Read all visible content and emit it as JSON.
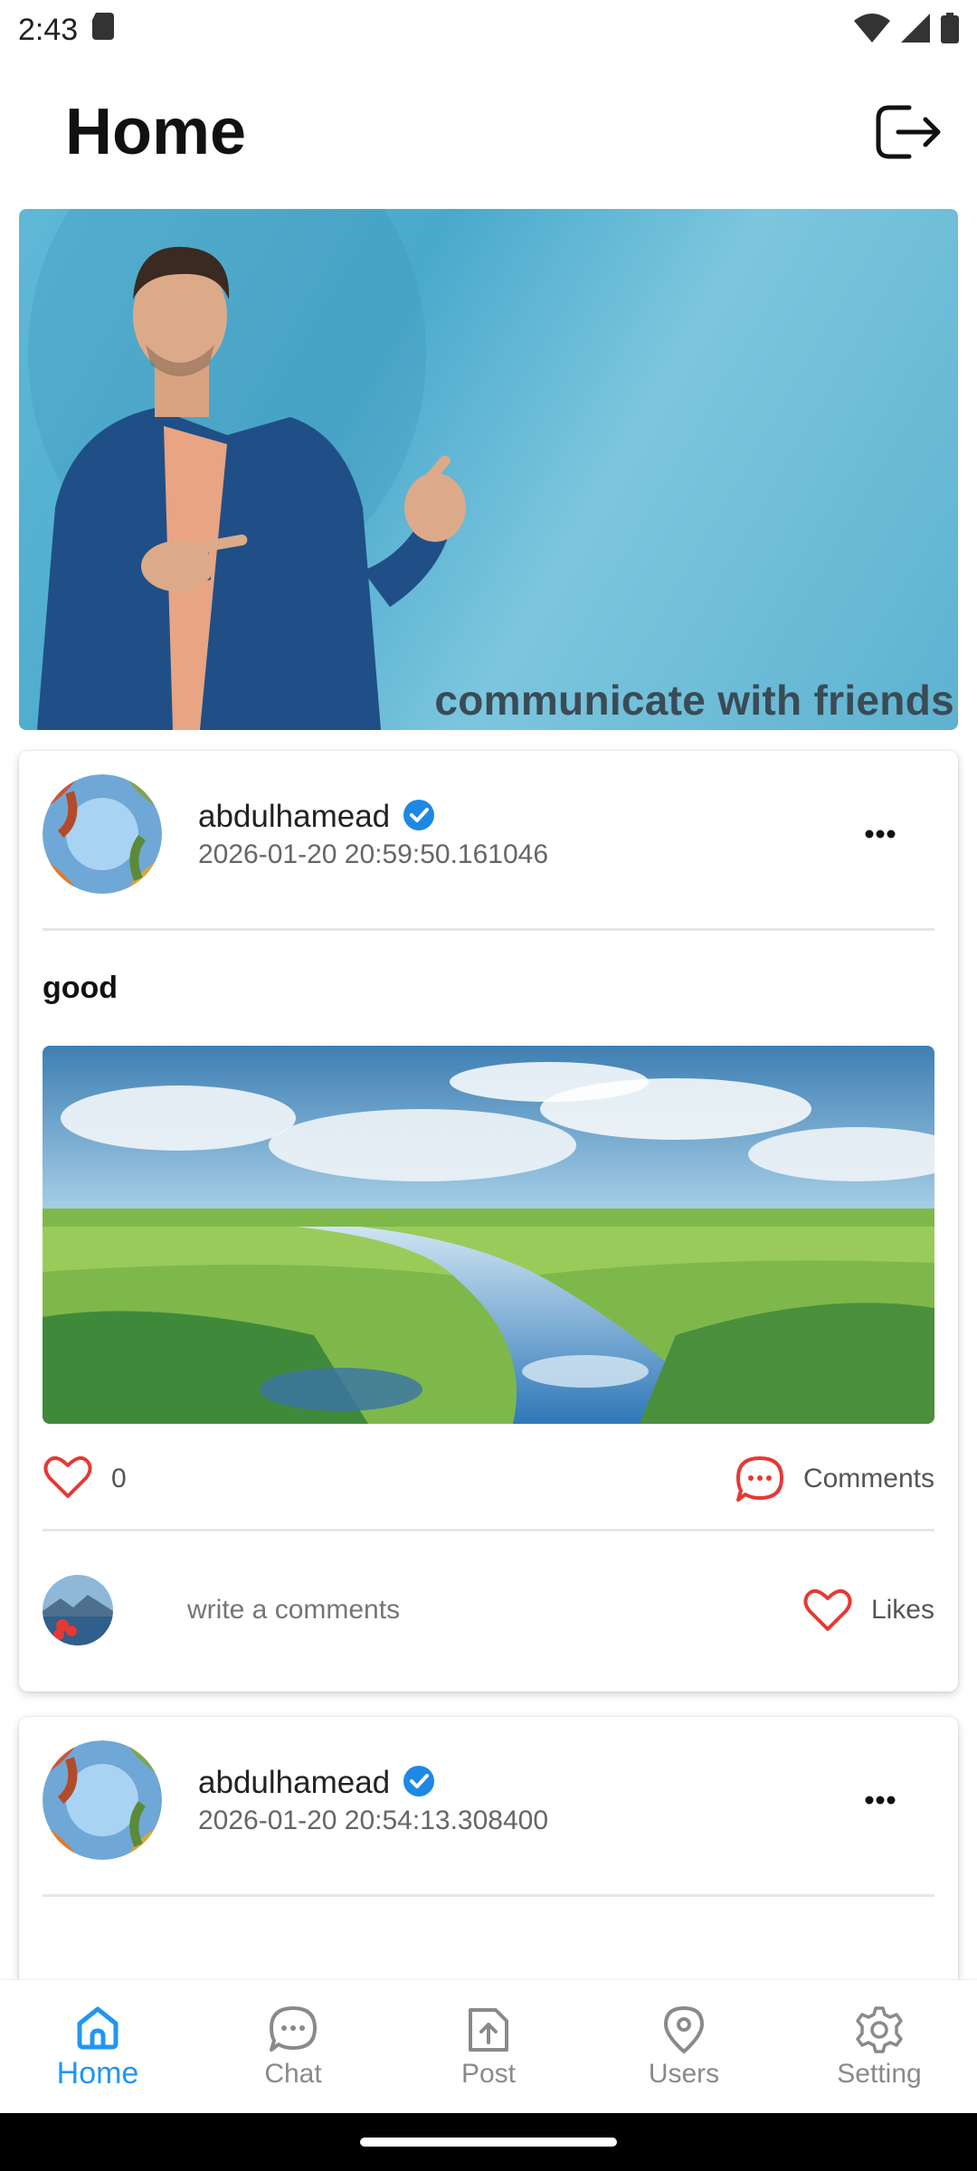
{
  "status_bar": {
    "time": "2:43"
  },
  "app_bar": {
    "title": "Home"
  },
  "banner": {
    "caption": "communicate with friends"
  },
  "posts": [
    {
      "author": "abdulhamead",
      "timestamp": "2026-01-20 20:59:50.161046",
      "text": "good",
      "like_count": "0",
      "comments_label": "Comments",
      "comment_placeholder": "write a comments",
      "likes_label": "Likes"
    },
    {
      "author": "abdulhamead",
      "timestamp": "2026-01-20 20:54:13.308400"
    }
  ],
  "bottom_nav": {
    "items": [
      {
        "label": "Home",
        "icon": "home-icon",
        "active": true
      },
      {
        "label": "Chat",
        "icon": "chat-icon",
        "active": false
      },
      {
        "label": "Post",
        "icon": "upload-icon",
        "active": false
      },
      {
        "label": "Users",
        "icon": "location-pin-icon",
        "active": false
      },
      {
        "label": "Setting",
        "icon": "gear-icon",
        "active": false
      }
    ]
  },
  "colors": {
    "accent": "#2196f3",
    "heart": "#e53935",
    "verified": "#1e88e5",
    "inactive": "#8a8a8a"
  }
}
